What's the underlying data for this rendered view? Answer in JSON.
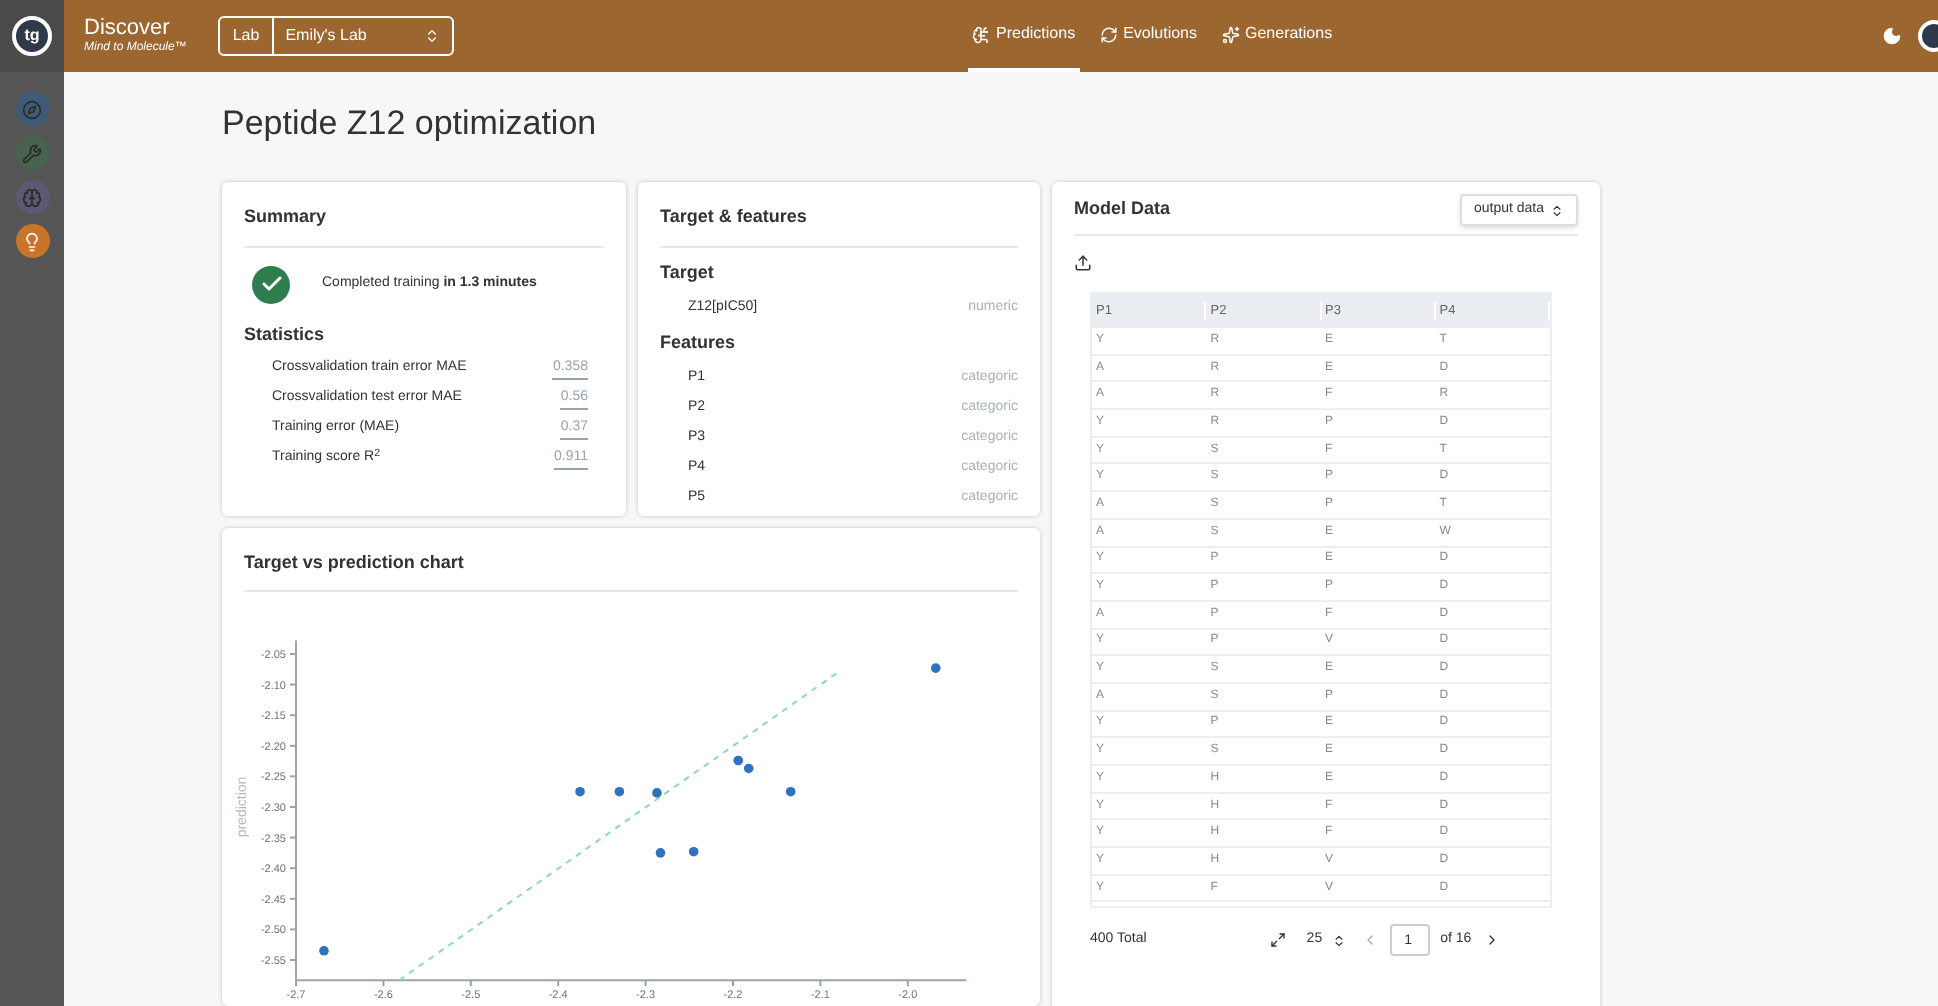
{
  "app": {
    "logo": "tg",
    "name": "Discover",
    "tagline": "Mind to Molecule™",
    "lab_label": "Lab",
    "lab_value": "Emily's Lab"
  },
  "nav_tabs": [
    {
      "label": "Predictions",
      "selected": true,
      "kind": "predictions"
    },
    {
      "label": "Evolutions",
      "selected": false,
      "kind": "evolutions"
    },
    {
      "label": "Generations",
      "selected": false,
      "kind": "generations"
    }
  ],
  "sidebar": {
    "items": [
      {
        "kind": "compass",
        "color": "#3d5a78",
        "selected": false
      },
      {
        "kind": "wrench",
        "color": "#48624d",
        "selected": false
      },
      {
        "kind": "brain",
        "color": "#5f5873",
        "selected": false
      },
      {
        "kind": "bulb",
        "color": "#c8742a",
        "selected": true
      }
    ]
  },
  "page_title": "Peptide Z12 optimization",
  "summary": {
    "title": "Summary",
    "status": "Completed training **in 1.3 minutes**",
    "statistics_title": "Statistics",
    "statistics": [
      {
        "label": "Crossvalidation train error MAE",
        "value": "0.358"
      },
      {
        "label": "Crossvalidation test error MAE",
        "value": "0.56"
      },
      {
        "label": "Training error (MAE)",
        "value": "0.37"
      },
      {
        "label": "Training score R$^{2}$",
        "value": "0.911"
      }
    ]
  },
  "target_features": {
    "title": "Target & features",
    "target_title": "Target",
    "target": [
      {
        "name": "Z12[pIC50]",
        "type": "numeric"
      }
    ],
    "features_title": "Features",
    "features": [
      {
        "name": "P1",
        "type": "categoric"
      },
      {
        "name": "P2",
        "type": "categoric"
      },
      {
        "name": "P3",
        "type": "categoric"
      },
      {
        "name": "P4",
        "type": "categoric"
      },
      {
        "name": "P5",
        "type": "categoric"
      }
    ]
  },
  "chart_card": {
    "title": "Target vs prediction chart",
    "chart_data": {
      "type": "scatter",
      "ylabel": "prediction",
      "xlim": [
        -2.7,
        -1.933
      ],
      "ylim": [
        -2.583,
        -2.028
      ],
      "xticks": [
        {
          "value": -2.7,
          "label": "-2.7"
        },
        {
          "value": -2.6,
          "label": "-2.6"
        },
        {
          "value": -2.5,
          "label": "-2.5"
        },
        {
          "value": -2.4,
          "label": "-2.4"
        },
        {
          "value": -2.3,
          "label": "-2.3"
        },
        {
          "value": -2.2,
          "label": "-2.2"
        },
        {
          "value": -2.1,
          "label": "-2.1"
        },
        {
          "value": -2.0,
          "label": "-2.0"
        }
      ],
      "yticks": [
        {
          "value": -2.05,
          "label": "-2.05"
        },
        {
          "value": -2.1,
          "label": "-2.10"
        },
        {
          "value": -2.15,
          "label": "-2.15"
        },
        {
          "value": -2.2,
          "label": "-2.20"
        },
        {
          "value": -2.25,
          "label": "-2.25"
        },
        {
          "value": -2.3,
          "label": "-2.30"
        },
        {
          "value": -2.35,
          "label": "-2.35"
        },
        {
          "value": -2.4,
          "label": "-2.40"
        },
        {
          "value": -2.45,
          "label": "-2.45"
        },
        {
          "value": -2.5,
          "label": "-2.50"
        },
        {
          "value": -2.55,
          "label": "-2.55"
        }
      ],
      "series": [
        {
          "type": "line",
          "line_style": "dashed",
          "color": "#8fd9b0",
          "x": [
            -2.582,
            -2.078
          ],
          "values": [
            -2.583,
            -2.078
          ]
        },
        {
          "color": "#2f72bd",
          "x": [
            -2.668,
            -2.375,
            -2.33,
            -2.287,
            -2.283,
            -2.245,
            -2.194,
            -2.182,
            -2.134,
            -1.968
          ],
          "values": [
            -2.535,
            -2.275,
            -2.275,
            -2.277,
            -2.375,
            -2.373,
            -2.224,
            -2.237,
            -2.275,
            -2.073
          ]
        }
      ]
    }
  },
  "model_data": {
    "title": "Model Data",
    "view_select": "output data",
    "columns": [
      "P1",
      "P2",
      "P3",
      "P4"
    ],
    "rows": [
      [
        "Y",
        "R",
        "E",
        "T"
      ],
      [
        "A",
        "R",
        "E",
        "D"
      ],
      [
        "A",
        "R",
        "F",
        "R"
      ],
      [
        "Y",
        "R",
        "P",
        "D"
      ],
      [
        "Y",
        "S",
        "F",
        "T"
      ],
      [
        "Y",
        "S",
        "P",
        "D"
      ],
      [
        "A",
        "S",
        "P",
        "T"
      ],
      [
        "A",
        "S",
        "E",
        "W"
      ],
      [
        "Y",
        "P",
        "E",
        "D"
      ],
      [
        "Y",
        "P",
        "P",
        "D"
      ],
      [
        "A",
        "P",
        "F",
        "D"
      ],
      [
        "Y",
        "P",
        "V",
        "D"
      ],
      [
        "Y",
        "S",
        "E",
        "D"
      ],
      [
        "A",
        "S",
        "P",
        "D"
      ],
      [
        "Y",
        "P",
        "E",
        "D"
      ],
      [
        "Y",
        "S",
        "E",
        "D"
      ],
      [
        "Y",
        "H",
        "E",
        "D"
      ],
      [
        "Y",
        "H",
        "F",
        "D"
      ],
      [
        "Y",
        "H",
        "F",
        "D"
      ],
      [
        "Y",
        "H",
        "V",
        "D"
      ],
      [
        "Y",
        "F",
        "V",
        "D"
      ]
    ],
    "total": "400 Total",
    "page_size": "25",
    "page": "1",
    "page_count": "of 16"
  }
}
